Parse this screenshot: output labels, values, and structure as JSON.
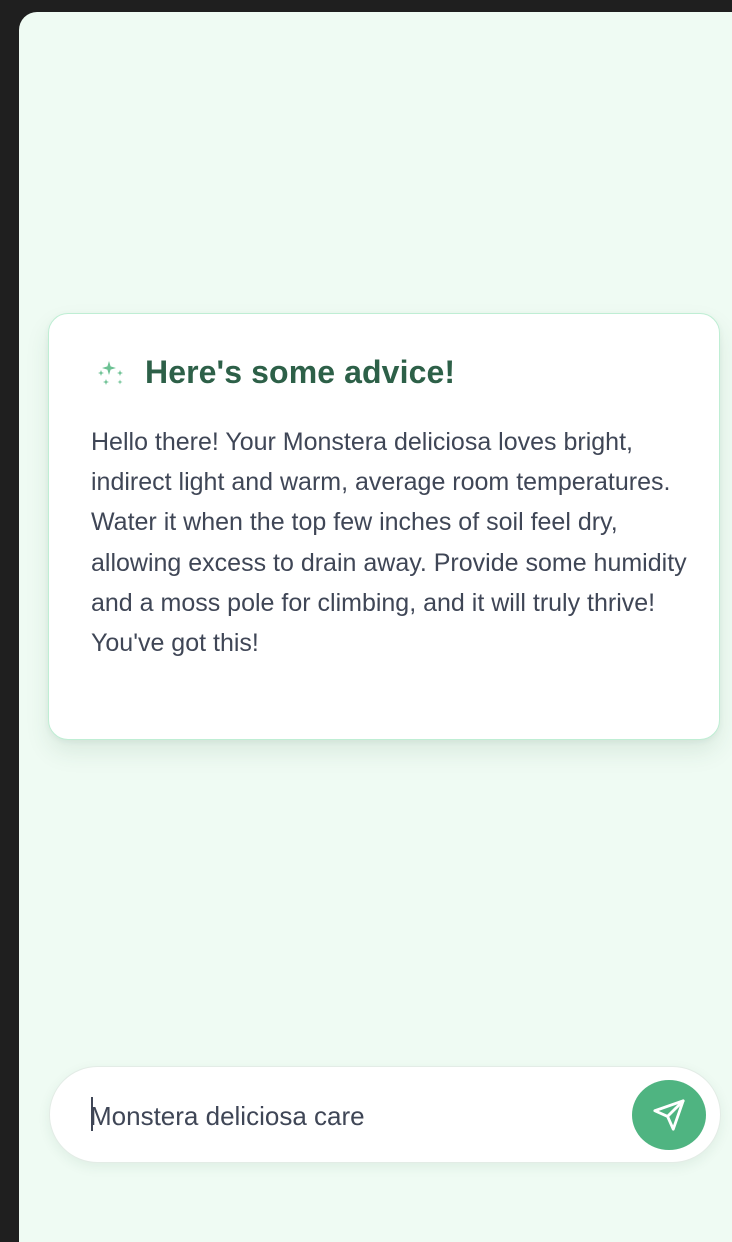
{
  "advice_card": {
    "title": "Here's some advice!",
    "icon": "sparkles-icon",
    "body": "Hello there! Your Monstera deliciosa loves bright, indirect light and warm, average room temperatures. Water it when the top few inches of soil feel dry, allowing excess to drain away. Provide some humidity and a moss pole for climbing, and it will truly thrive! You've got this!"
  },
  "search": {
    "value": "Monstera deliciosa care",
    "send_icon": "send-icon"
  },
  "colors": {
    "background": "#effbf3",
    "card_border": "#bfeed4",
    "title": "#2d6048",
    "accent": "#4fb481",
    "body_text": "#3f4656"
  }
}
